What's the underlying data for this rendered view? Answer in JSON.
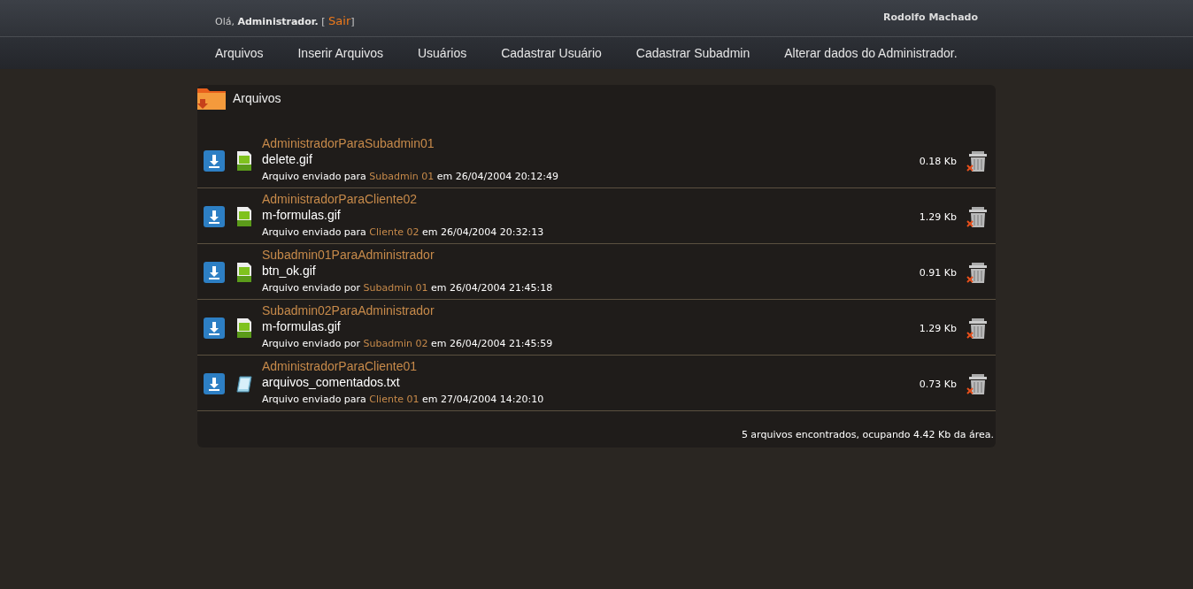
{
  "header": {
    "greeting": "Olá, **Administrador.** [",
    "logout_link": "Sair",
    "greeting_end": "]",
    "user_name": "Rodolfo Machado"
  },
  "nav": [
    {
      "label": "Arquivos"
    },
    {
      "label": "Inserir Arquivos"
    },
    {
      "label": "Usuários"
    },
    {
      "label": "Cadastrar Usuário"
    },
    {
      "label": "Cadastrar Subadmin"
    },
    {
      "label": "Alterar dados do Administrador."
    }
  ],
  "panel": {
    "title": "Arquivos",
    "files": [
      {
        "folder": "AdministradorParaSubadmin01",
        "name": "delete.gif",
        "kind": "gif",
        "sent_prefix": "Arquivo enviado para",
        "party": "Subadmin 01",
        "sent_suffix": "em 26/04/2004 20:12:49",
        "size": "0.18 Kb"
      },
      {
        "folder": "AdministradorParaCliente02",
        "name": "m-formulas.gif",
        "kind": "gif",
        "sent_prefix": "Arquivo enviado para",
        "party": "Cliente 02",
        "sent_suffix": "em 26/04/2004 20:32:13",
        "size": "1.29 Kb"
      },
      {
        "folder": "Subadmin01ParaAdministrador",
        "name": "btn_ok.gif",
        "kind": "gif",
        "sent_prefix": "Arquivo enviado por",
        "party": "Subadmin 01",
        "sent_suffix": "em 26/04/2004 21:45:18",
        "size": "0.91 Kb"
      },
      {
        "folder": "Subadmin02ParaAdministrador",
        "name": "m-formulas.gif",
        "kind": "gif",
        "sent_prefix": "Arquivo enviado por",
        "party": "Subadmin 02",
        "sent_suffix": "em 26/04/2004 21:45:59",
        "size": "1.29 Kb"
      },
      {
        "folder": "AdministradorParaCliente01",
        "name": "arquivos_comentados.txt",
        "kind": "txt",
        "sent_prefix": "Arquivo enviado para",
        "party": "Cliente 01",
        "sent_suffix": "em 27/04/2004 14:20:10",
        "size": "0.73 Kb"
      }
    ],
    "summary": "5 arquivos encontrados, ocupando 4.42 Kb da área."
  }
}
